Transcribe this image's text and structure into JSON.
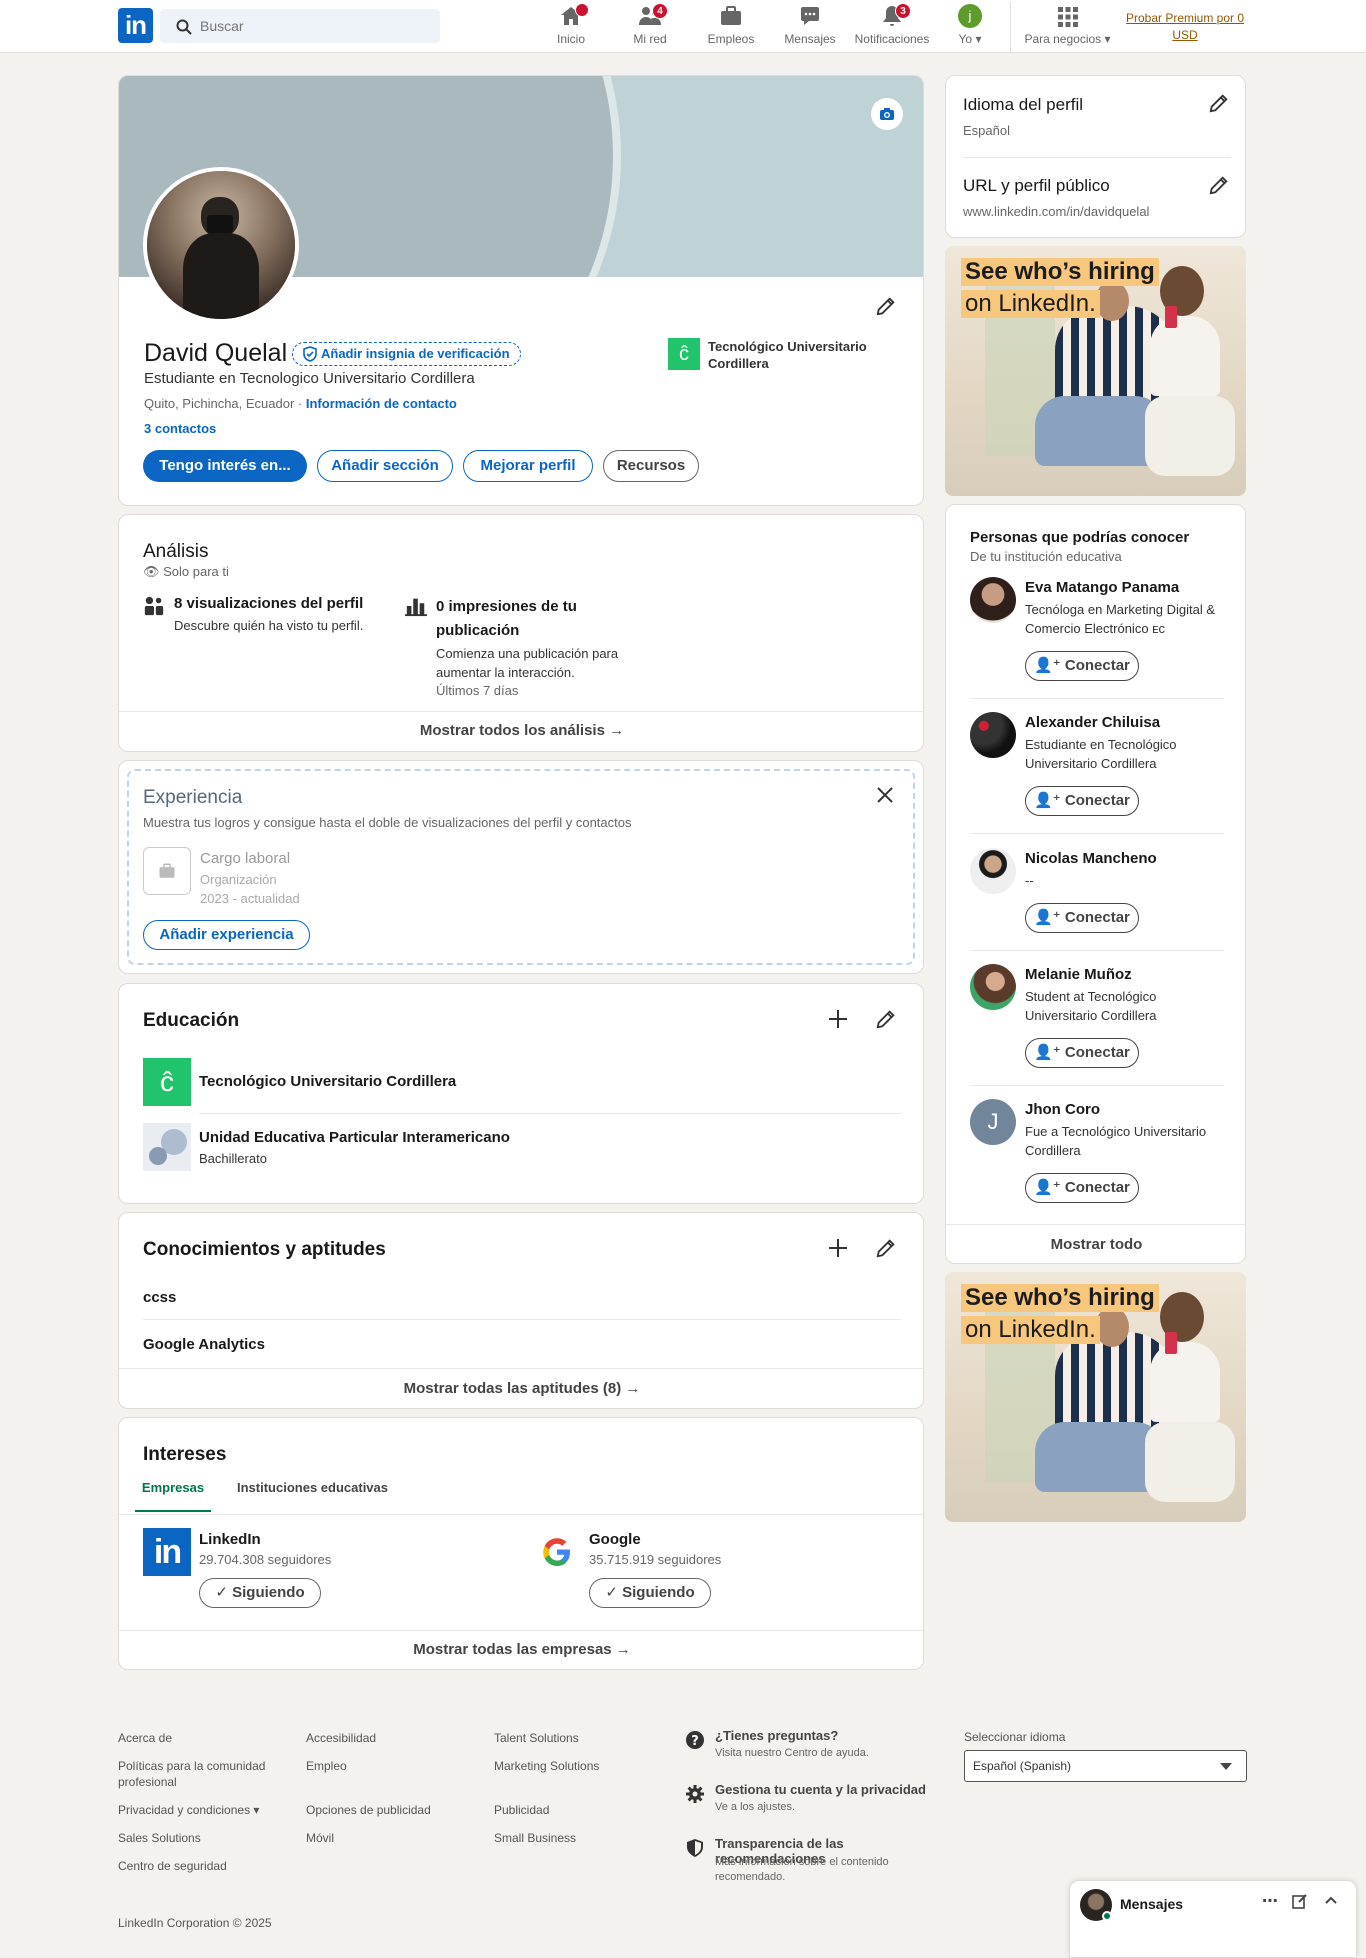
{
  "nav": {
    "logo": "in",
    "search_placeholder": "Buscar",
    "items": [
      {
        "label": "Inicio",
        "badge": ""
      },
      {
        "label": "Mi red",
        "badge": "4"
      },
      {
        "label": "Empleos",
        "badge": ""
      },
      {
        "label": "Mensajes",
        "badge": ""
      },
      {
        "label": "Notificaciones",
        "badge": "3"
      },
      {
        "label": "Yo",
        "badge": ""
      },
      {
        "label": "Para negocios",
        "badge": ""
      }
    ],
    "me_avatar_letter": "j",
    "premium": "Probar Premium por 0 USD"
  },
  "profile": {
    "name": "David Quelal",
    "verify": "Añadir insignia de verificación",
    "headline": "Estudiante en Tecnologico Universitario Cordillera",
    "location": "Quito, Pichincha, Ecuador",
    "contact_info": "Información de contacto",
    "connections": "3 contactos",
    "org": "Tecnológico Universitario Cordillera",
    "buttons": {
      "interest": "Tengo interés en...",
      "add_section": "Añadir sección",
      "improve": "Mejorar perfil",
      "resources": "Recursos"
    }
  },
  "analytics": {
    "title": "Análisis",
    "private": "Solo para ti",
    "views_title": "8 visualizaciones del perfil",
    "views_sub": "Descubre quién ha visto tu perfil.",
    "impr_title": "0 impresiones de tu publicación",
    "impr_sub": "Comienza una publicación para aumentar la interacción.",
    "impr_period": "Últimos 7 días",
    "show_all": "Mostrar todos los análisis →"
  },
  "experience": {
    "title": "Experiencia",
    "subtitle": "Muestra tus logros y consigue hasta el doble de visualizaciones del perfil y contactos",
    "job": "Cargo laboral",
    "org": "Organización",
    "dates": "2023 - actualidad",
    "add": "Añadir experiencia"
  },
  "education": {
    "title": "Educación",
    "items": [
      {
        "name": "Tecnológico Universitario Cordillera",
        "sub": ""
      },
      {
        "name": "Unidad Educativa Particular Interamericano",
        "sub": "Bachillerato"
      }
    ]
  },
  "skills": {
    "title": "Conocimientos y aptitudes",
    "items": [
      "ccss",
      "Google Analytics"
    ],
    "show_all": "Mostrar todas las aptitudes (8) →"
  },
  "interests": {
    "title": "Intereses",
    "tabs": [
      "Empresas",
      "Instituciones educativas"
    ],
    "companies": [
      {
        "name": "LinkedIn",
        "followers": "29.704.308 seguidores",
        "button": "✓ Siguiendo"
      },
      {
        "name": "Google",
        "followers": "35.715.919 seguidores",
        "button": "✓ Siguiendo"
      }
    ],
    "show_all": "Mostrar todas las empresas →"
  },
  "sidebar": {
    "lang_title": "Idioma del perfil",
    "lang_value": "Español",
    "url_title": "URL y perfil público",
    "url_value": "www.linkedin.com/in/davidquelal",
    "ad_line1": "See who’s hiring",
    "ad_line2": "on LinkedIn.",
    "pymk_title": "Personas que podrías conocer",
    "pymk_sub": "De tu institución educativa",
    "connect": "Conectar",
    "people": [
      {
        "name": "Eva Matango Panama",
        "headline": "Tecnóloga en Marketing Digital & Comercio Electrónico ᴇᴄ"
      },
      {
        "name": "Alexander Chiluisa",
        "headline": "Estudiante en Tecnológico Universitario Cordillera"
      },
      {
        "name": "Nicolas Mancheno",
        "headline": "--"
      },
      {
        "name": "Melanie Muñoz",
        "headline": "Student at Tecnológico Universitario Cordillera"
      },
      {
        "name": "Jhon Coro",
        "headline": "Fue a Tecnológico Universitario Cordillera",
        "initial": "J"
      }
    ],
    "show_all": "Mostrar todo"
  },
  "footer": {
    "col1": [
      "Acerca de",
      "Políticas para la comunidad profesional",
      "Privacidad y condiciones ▾",
      "Sales Solutions",
      "Centro de seguridad"
    ],
    "col2": [
      "Accesibilidad",
      "Empleo",
      "Opciones de publicidad",
      "Móvil"
    ],
    "col3": [
      "Talent Solutions",
      "Marketing Solutions",
      "Publicidad",
      "Small Business"
    ],
    "help": [
      {
        "title": "¿Tienes preguntas?",
        "sub": "Visita nuestro Centro de ayuda."
      },
      {
        "title": "Gestiona tu cuenta y la privacidad",
        "sub": "Ve a los ajustes."
      },
      {
        "title": "Transparencia de las recomendaciones",
        "sub": "Más información sobre el contenido recomendado."
      }
    ],
    "lang_label": "Seleccionar idioma",
    "lang_value": "Español (Spanish)",
    "copyright": "LinkedIn Corporation © 2025"
  },
  "messaging": {
    "title": "Mensajes"
  },
  "colors": {
    "brand": "#0a66c2",
    "badge": "#cb112d",
    "school": "#21c36b"
  }
}
